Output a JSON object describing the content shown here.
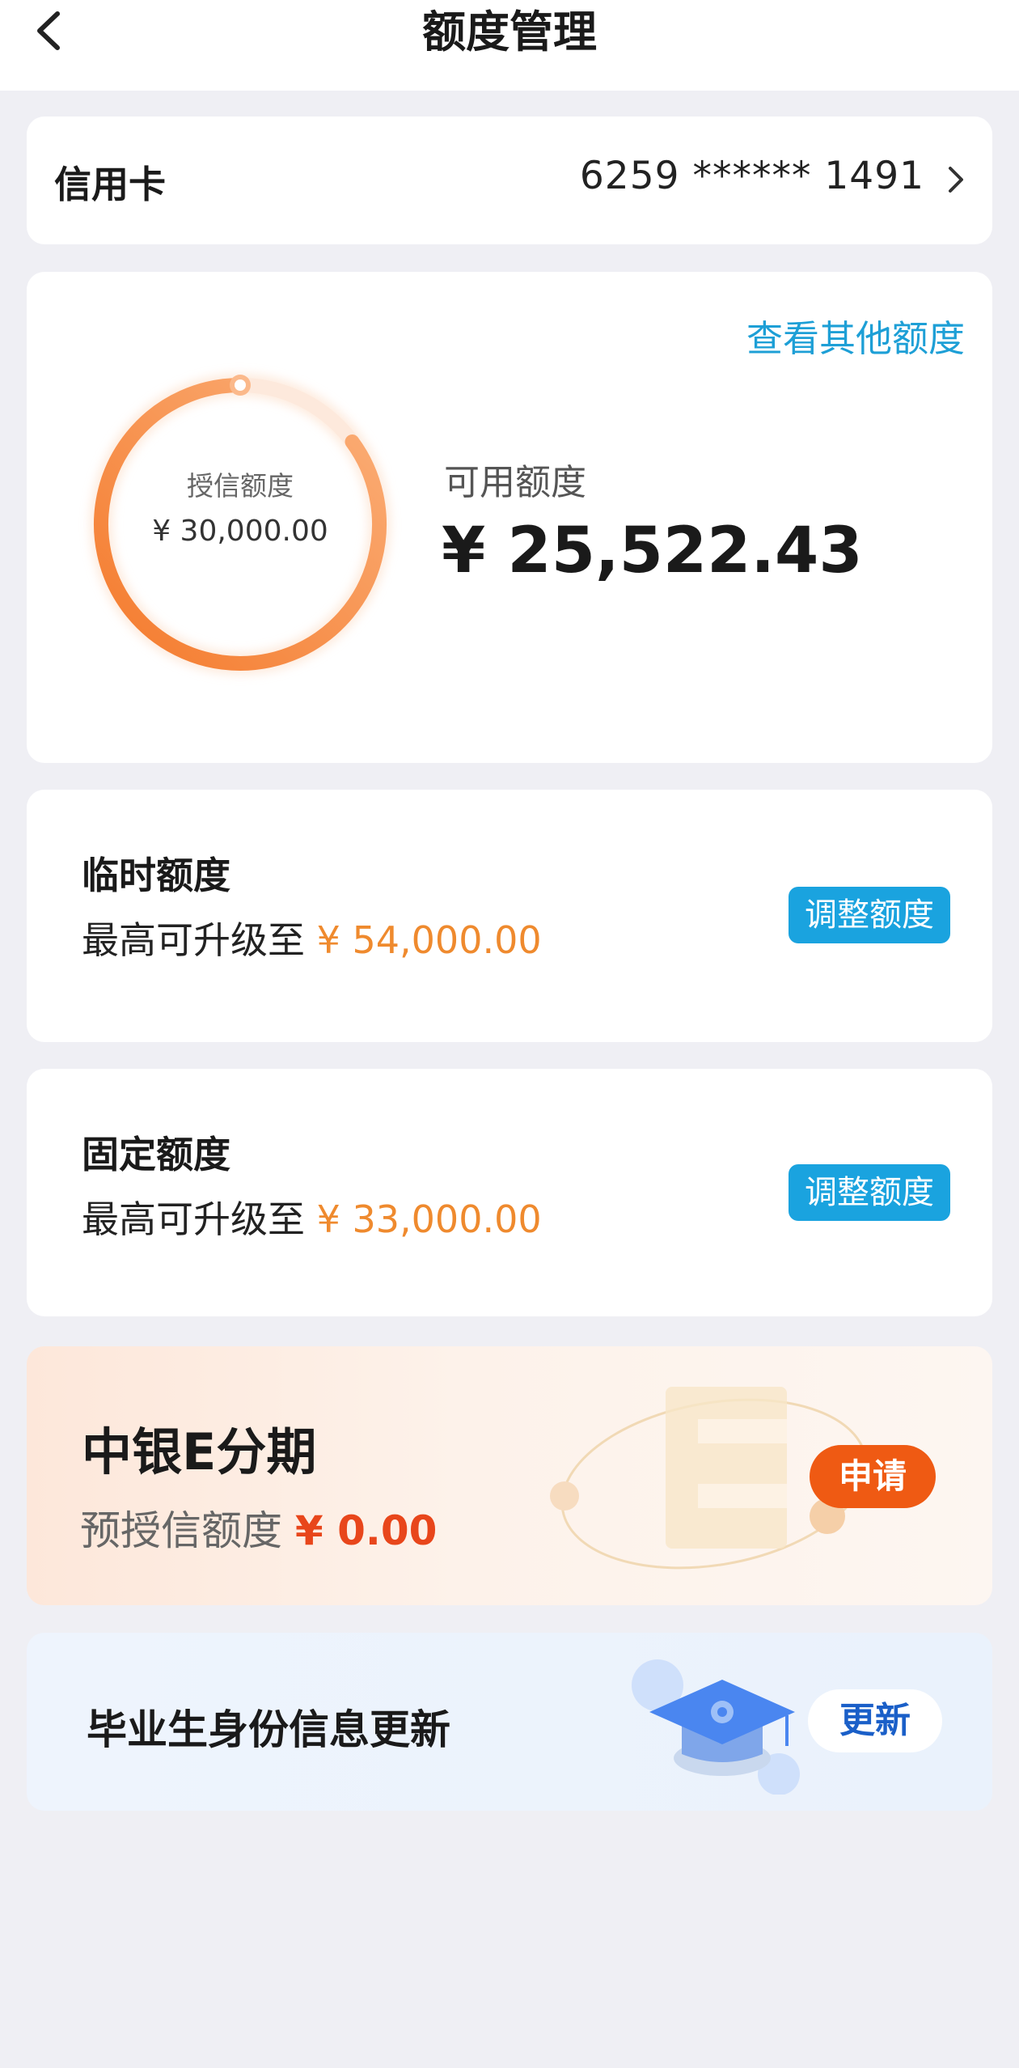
{
  "header": {
    "title": "额度管理"
  },
  "credit_card": {
    "label": "信用卡",
    "number": "6259 ****** 1491"
  },
  "quota": {
    "view_other": "查看其他额度",
    "ring_label": "授信额度",
    "ring_value": "¥ 30,000.00",
    "available_label": "可用额度",
    "available_value": "¥ 25,522.43",
    "used_fraction": 0.149
  },
  "temp_quota": {
    "title": "临时额度",
    "sub_prefix": "最高可升级至",
    "amount": "¥ 54,000.00",
    "button": "调整额度"
  },
  "fixed_quota": {
    "title": "固定额度",
    "sub_prefix": "最高可升级至",
    "amount": "¥ 33,000.00",
    "button": "调整额度"
  },
  "e_installment": {
    "title": "中银E分期",
    "sub_prefix": "预授信额度",
    "amount": "¥ 0.00",
    "button": "申请"
  },
  "graduate": {
    "title": "毕业生身份信息更新",
    "button": "更新"
  },
  "colors": {
    "accent_blue": "#1aa3df",
    "amount_orange": "#ef8a2e",
    "apply_orange": "#ef5a13",
    "ring_orange": "#f7843a"
  }
}
